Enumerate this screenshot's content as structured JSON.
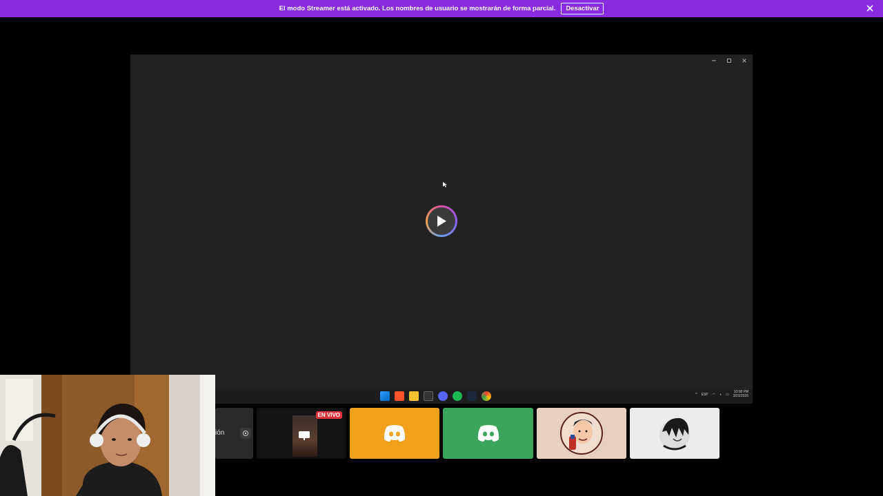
{
  "banner": {
    "message": "El modo Streamer está activado. Los nombres de usuario se mostrarán de forma parcial.",
    "button_label": "Desactivar",
    "background": "#8a2be2"
  },
  "stream": {
    "background": "#222222",
    "play_icon": "play-icon",
    "taskbar": {
      "lang": "ESP",
      "time": "10:08 PM",
      "date": "3/23/2026"
    }
  },
  "participants": {
    "partial_label": "ión",
    "live_badge": "EN VIVO",
    "tiles": [
      {
        "name": "discord-tile-orange",
        "color": "#f0a21d"
      },
      {
        "name": "discord-tile-green",
        "color": "#3ba55c"
      },
      {
        "name": "avatar-tile-1",
        "color": "#e8cfc0"
      },
      {
        "name": "avatar-tile-2",
        "color": "#ececec"
      }
    ]
  },
  "icons": {
    "banner_close": "close-icon",
    "minimize": "minimize-icon",
    "maximize": "maximize-icon",
    "close": "close-icon",
    "discord": "discord-icon",
    "screen_share": "screen-share-icon"
  }
}
